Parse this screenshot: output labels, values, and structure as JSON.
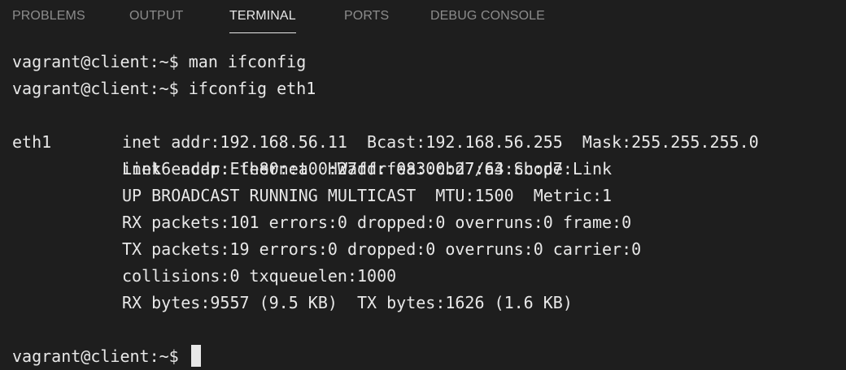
{
  "panel_tabs": [
    {
      "label": "PROBLEMS",
      "active": false
    },
    {
      "label": "OUTPUT",
      "active": false
    },
    {
      "label": "TERMINAL",
      "active": true
    },
    {
      "label": "PORTS",
      "active": false
    },
    {
      "label": "DEBUG CONSOLE",
      "active": false
    }
  ],
  "terminal": {
    "prompt": "vagrant@client:~$ ",
    "commands": [
      "man ifconfig",
      "ifconfig eth1"
    ],
    "output": {
      "interface": "eth1",
      "details": [
        "Link encap:Ethernet  HWaddr 08:00:27:a3:cb:d7",
        "inet addr:192.168.56.11  Bcast:192.168.56.255  Mask:255.255.255.0",
        "inet6 addr: fe80::a00:27ff:fea3:cbd7/64 Scope:Link",
        "UP BROADCAST RUNNING MULTICAST  MTU:1500  Metric:1",
        "RX packets:101 errors:0 dropped:0 overruns:0 frame:0",
        "TX packets:19 errors:0 dropped:0 overruns:0 carrier:0",
        "collisions:0 txqueuelen:1000",
        "RX bytes:9557 (9.5 KB)  TX bytes:1626 (1.6 KB)"
      ]
    },
    "colors": {
      "background": "#1e1e1e",
      "text": "#e8e8e8",
      "tab_inactive": "#8c8c8c",
      "tab_active": "#e7e7e7"
    }
  }
}
